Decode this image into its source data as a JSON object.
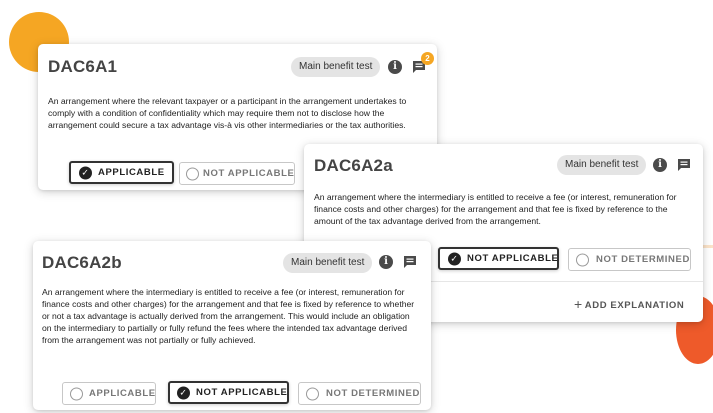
{
  "cards": [
    {
      "title": "DAC6A1",
      "tag": "Main benefit test",
      "comment_count": "2",
      "description": "An arrangement where the relevant taxpayer or a participant in the arrangement undertakes to comply with a condition of confidentiality which may require them not to disclose how the arrangement could secure a tax advantage vis-à vis other intermediaries or the tax authorities.",
      "options": [
        {
          "label": "APPLICABLE",
          "selected": true
        },
        {
          "label": "NOT APPLICABLE",
          "selected": false
        }
      ]
    },
    {
      "title": "DAC6A2a",
      "tag": "Main benefit test",
      "description": "An arrangement where the intermediary is entitled to receive a fee (or interest, remuneration for finance costs and other charges) for the arrangement and that fee is fixed by reference to the amount of the tax advantage derived from the arrangement.",
      "options": [
        {
          "label": "NOT APPLICABLE",
          "selected": true
        },
        {
          "label": "NOT DETERMINED",
          "selected": false
        }
      ],
      "add_explanation": "ADD EXPLANATION"
    },
    {
      "title": "DAC6A2b",
      "tag": "Main benefit test",
      "description": "An arrangement where the intermediary is entitled to receive a fee (or interest, remuneration for finance costs and other charges) for the arrangement and that fee is fixed by reference to whether or not a tax advantage is actually derived from the arrangement. This would include an obligation on the intermediary to partially or fully refund the fees where the intended tax advantage derived from the arrangement was not partially or fully achieved.",
      "options": [
        {
          "label": "APPLICABLE",
          "selected": false
        },
        {
          "label": "NOT APPLICABLE",
          "selected": true
        },
        {
          "label": "NOT DETERMINED",
          "selected": false
        }
      ]
    }
  ],
  "icons": {
    "info": "info-icon",
    "comment": "comment-icon",
    "check": "check-circle-icon",
    "radio": "radio-empty-icon",
    "plus": "plus-icon"
  },
  "colors": {
    "accent_orange": "#f5a623",
    "accent_red": "#ee5a2a",
    "selected_border": "#333333",
    "tag_bg": "#e4e4e4"
  }
}
